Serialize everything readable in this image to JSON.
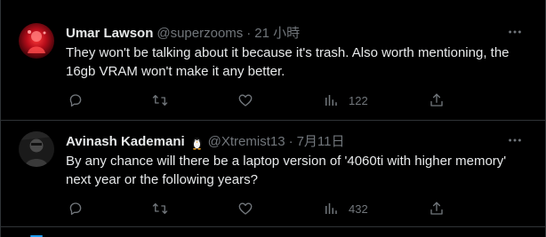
{
  "theme": {
    "background": "#000000",
    "text": "#e7e9ea",
    "muted": "#71767b",
    "border": "#2f3336"
  },
  "tweets": [
    {
      "name": "Umar Lawson",
      "handle": "@superzooms",
      "separator": "·",
      "time": "21 小時",
      "text": "They won't be talking about it because it's trash. Also worth mentioning, the 16gb VRAM won't make it any better.",
      "avatar_icon": "red-figure-avatar",
      "name_badge_icon": "",
      "actions": {
        "reply_count": "",
        "retweet_count": "",
        "like_count": "",
        "views_count": "122"
      }
    },
    {
      "name": "Avinash Kademani",
      "handle": "@Xtremist13",
      "separator": "·",
      "time": "7月11日",
      "text": "By any chance will there be a laptop version of '4060ti with higher memory' next year or the following years?",
      "avatar_icon": "dark-portrait-avatar",
      "name_badge_icon": "penguin-emoji-icon",
      "actions": {
        "reply_count": "",
        "retweet_count": "",
        "like_count": "",
        "views_count": "432"
      }
    }
  ]
}
